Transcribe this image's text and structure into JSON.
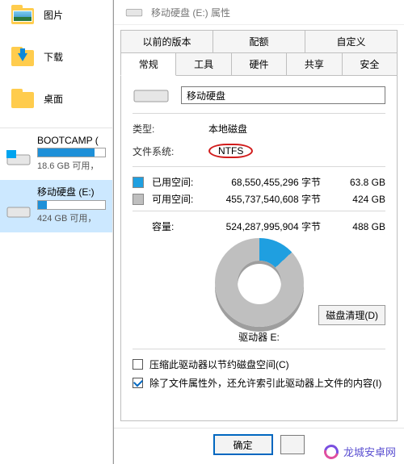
{
  "explorer": {
    "nav": [
      {
        "label": "图片",
        "icon": "pictures-folder-icon"
      },
      {
        "label": "下载",
        "icon": "downloads-folder-icon"
      },
      {
        "label": "桌面",
        "icon": "desktop-folder-icon"
      }
    ],
    "drives": [
      {
        "name": "BOOTCAMP (",
        "sub": "18.6 GB 可用，",
        "fill_pct": 84,
        "selected": false,
        "os_icon": true
      },
      {
        "name": "移动硬盘 (E:)",
        "sub": "424 GB 可用，",
        "fill_pct": 13,
        "selected": true,
        "os_icon": false
      }
    ]
  },
  "dialog": {
    "title": "移动硬盘 (E:) 属性",
    "tabs_top": [
      "以前的版本",
      "配额",
      "自定义"
    ],
    "tabs_bottom": [
      "常规",
      "工具",
      "硬件",
      "共享",
      "安全"
    ],
    "active_tab": "常规",
    "name_value": "移动硬盘",
    "rows": {
      "type_label": "类型:",
      "type_value": "本地磁盘",
      "fs_label": "文件系统:",
      "fs_value": "NTFS"
    },
    "space": {
      "used_label": "已用空间:",
      "used_bytes": "68,550,455,296 字节",
      "used_human": "63.8 GB",
      "free_label": "可用空间:",
      "free_bytes": "455,737,540,608 字节",
      "free_human": "424 GB",
      "cap_label": "容量:",
      "cap_bytes": "524,287,995,904 字节",
      "cap_human": "488 GB"
    },
    "drive_caption": "驱动器 E:",
    "cleanup_label": "磁盘清理(D)",
    "check1": "压缩此驱动器以节约磁盘空间(C)",
    "check2": "除了文件属性外，还允许索引此驱动器上文件的内容(I)",
    "check2_checked": true,
    "ok_label": "确定"
  },
  "watermark": {
    "text": "龙城安卓网"
  },
  "colors": {
    "accent_blue": "#1f9fe0",
    "highlight_red": "#d11b1b"
  },
  "chart_data": {
    "type": "pie",
    "title": "驱动器 E: 磁盘使用",
    "series": [
      {
        "name": "已用空间",
        "value": 63.8,
        "unit": "GB",
        "bytes": 68550455296,
        "color": "#1f9fe0"
      },
      {
        "name": "可用空间",
        "value": 424,
        "unit": "GB",
        "bytes": 455737540608,
        "color": "#bfbfbf"
      }
    ],
    "total": {
      "name": "容量",
      "value": 488,
      "unit": "GB",
      "bytes": 524287995904
    }
  }
}
